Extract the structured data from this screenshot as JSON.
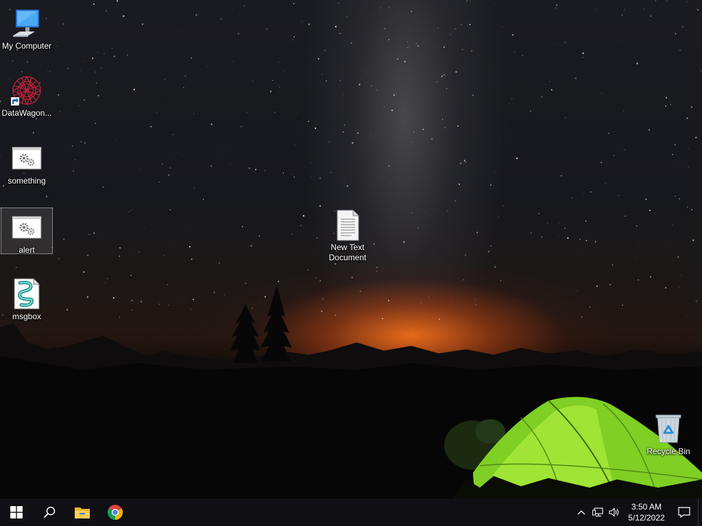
{
  "desktop": {
    "icons": [
      {
        "label": "My Computer",
        "icon": "monitor-icon"
      },
      {
        "label": "DataWagon...",
        "icon": "datawagon-shortcut-icon"
      },
      {
        "label": "something",
        "icon": "gear-window-icon"
      },
      {
        "label": "alert",
        "icon": "gear-window-icon"
      },
      {
        "label": "msgbox",
        "icon": "script-file-icon"
      },
      {
        "label": "New Text Document",
        "icon": "text-document-icon"
      },
      {
        "label": "Recycle Bin",
        "icon": "recycle-bin-icon"
      }
    ]
  },
  "taskbar": {
    "pinned": [
      "start-icon",
      "search-icon",
      "file-explorer-icon",
      "chrome-icon"
    ],
    "tray": [
      "chevron-up-icon",
      "network-icon",
      "volume-icon"
    ],
    "time": "3:50 AM",
    "date": "5/12/2022",
    "notification_icon": "action-center-icon"
  },
  "colors": {
    "taskbar_bg": "#101014",
    "sunset": "#e86a1c",
    "tent": "#8ed52a",
    "label_text": "#ffffff"
  }
}
